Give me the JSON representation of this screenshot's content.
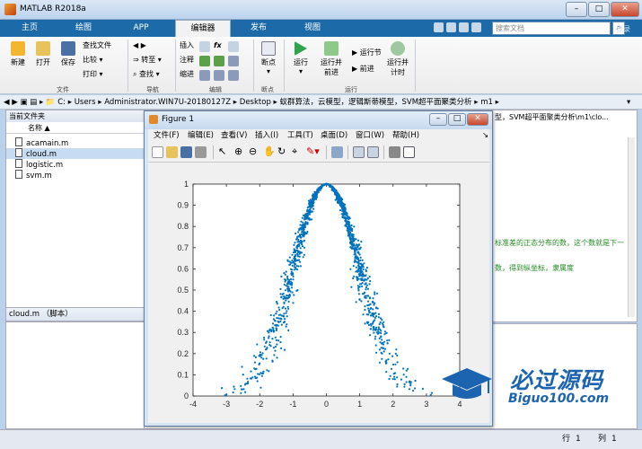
{
  "window": {
    "title": "MATLAB R2018a"
  },
  "tabs": [
    {
      "label": "主页"
    },
    {
      "label": "绘图"
    },
    {
      "label": "APP"
    },
    {
      "label": "编辑器"
    },
    {
      "label": "发布"
    },
    {
      "label": "视图"
    }
  ],
  "search": {
    "placeholder": "搜索文档",
    "login": "登录"
  },
  "toolbar": {
    "file": {
      "new": "新建",
      "open": "打开",
      "save": "保存",
      "find_files": "查找文件",
      "compare": "比较",
      "print": "打印",
      "section": "文件"
    },
    "nav": {
      "goto": "转至",
      "find": "查找",
      "section": "导航"
    },
    "edit": {
      "insert": "插入",
      "comment": "注释",
      "indent": "缩进",
      "fx": "fx",
      "section": "编辑"
    },
    "breakpoints": {
      "label": "断点",
      "section": "断点"
    },
    "run": {
      "run": "运行",
      "run_advance": "运行并前进",
      "run_section": "运行节",
      "advance": "前进",
      "run_time": "运行并计时",
      "section": "运行"
    }
  },
  "address": {
    "path": [
      "C:",
      "Users",
      "Administrator.WIN7U-20180127Z",
      "Desktop",
      "蚁群算法，云模型，逻辑斯蒂模型，SVM超平面聚类分析",
      "m1"
    ]
  },
  "current_folder": {
    "title": "当前文件夹",
    "column": "名称 ▲",
    "files": [
      {
        "name": "acamain.m"
      },
      {
        "name": "cloud.m"
      },
      {
        "name": "logistic.m"
      },
      {
        "name": "svm.m"
      }
    ],
    "details": "cloud.m （脚本）"
  },
  "editor": {
    "tab_title": "型，SVM超平面聚类分析\\m1\\clo...",
    "comment1": "标准差的正态分布的数，这个数就是下一",
    "comment2": "数，得到纵坐标，隶属度"
  },
  "statusbar": {
    "row_label": "行",
    "row": "1",
    "col_label": "列",
    "col": "1"
  },
  "figure": {
    "title": "Figure 1",
    "menu": [
      "文件(F)",
      "编辑(E)",
      "查看(V)",
      "插入(I)",
      "工具(T)",
      "桌面(D)",
      "窗口(W)",
      "帮助(H)"
    ]
  },
  "watermark": {
    "line1": "必过源码",
    "line2": "Biguo100.com"
  },
  "colors": {
    "accent": "#1c6aa8",
    "point": "#0072bd"
  },
  "chart_data": {
    "type": "scatter",
    "x_range": [
      -4,
      4
    ],
    "y_range": [
      0,
      1
    ],
    "x_ticks": [
      "-4",
      "-3",
      "-2",
      "-1",
      "0",
      "1",
      "2",
      "3",
      "4"
    ],
    "y_ticks": [
      "0",
      "0.1",
      "0.2",
      "0.3",
      "0.4",
      "0.5",
      "0.6",
      "0.7",
      "0.8",
      "0.9",
      "1"
    ],
    "points_description": "approx. Gaussian membership cloud, y = exp(-x^2/(2*En'^2)), centered at 0, peak 1",
    "center": 0,
    "peak": 1,
    "spread_x_range": [
      -3.3,
      3.3
    ],
    "grid": false
  }
}
